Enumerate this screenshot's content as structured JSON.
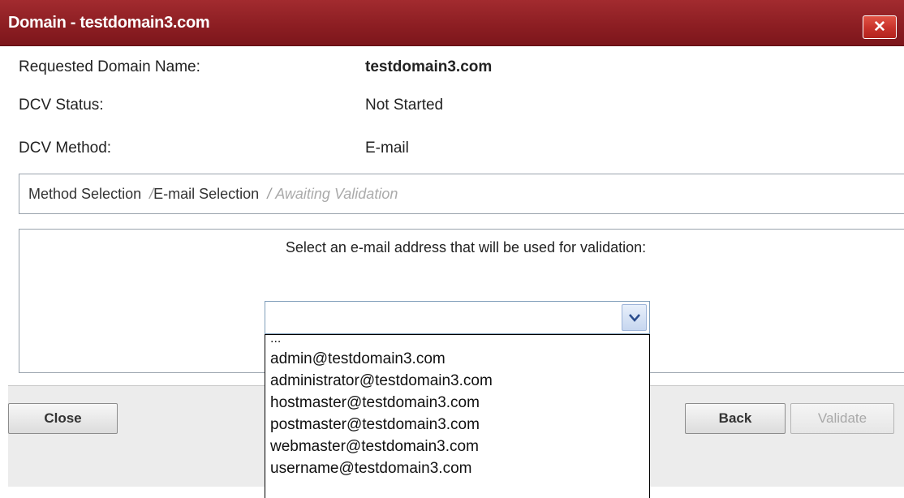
{
  "dialog": {
    "title": "Domain - testdomain3.com",
    "close_glyph": "✕"
  },
  "details": {
    "requested_domain_label": "Requested Domain Name:",
    "requested_domain_value": "testdomain3.com",
    "dcv_status_label": "DCV Status:",
    "dcv_status_value": "Not Started",
    "dcv_method_label": "DCV Method:",
    "dcv_method_value": "E-mail"
  },
  "breadcrumb": {
    "steps": [
      "Method Selection",
      "E-mail Selection",
      "Awaiting Validation"
    ],
    "separator": "/",
    "current_index": 1
  },
  "email_selection": {
    "prompt": "Select an e-mail address that will be used for validation:",
    "selected_value": "",
    "options": [
      "...",
      "admin@testdomain3.com",
      "administrator@testdomain3.com",
      "hostmaster@testdomain3.com",
      "postmaster@testdomain3.com",
      "webmaster@testdomain3.com",
      "username@testdomain3.com"
    ]
  },
  "footer": {
    "close_label": "Close",
    "back_label": "Back",
    "validate_label": "Validate",
    "validate_enabled": false
  },
  "icons": {
    "close": "close-icon",
    "dropdown": "chevron-down-icon"
  },
  "colors": {
    "titlebar": "#8b1d22",
    "close_button": "#c7312a",
    "panel_border": "#9aa3ad",
    "footer_bg": "#ececec"
  }
}
